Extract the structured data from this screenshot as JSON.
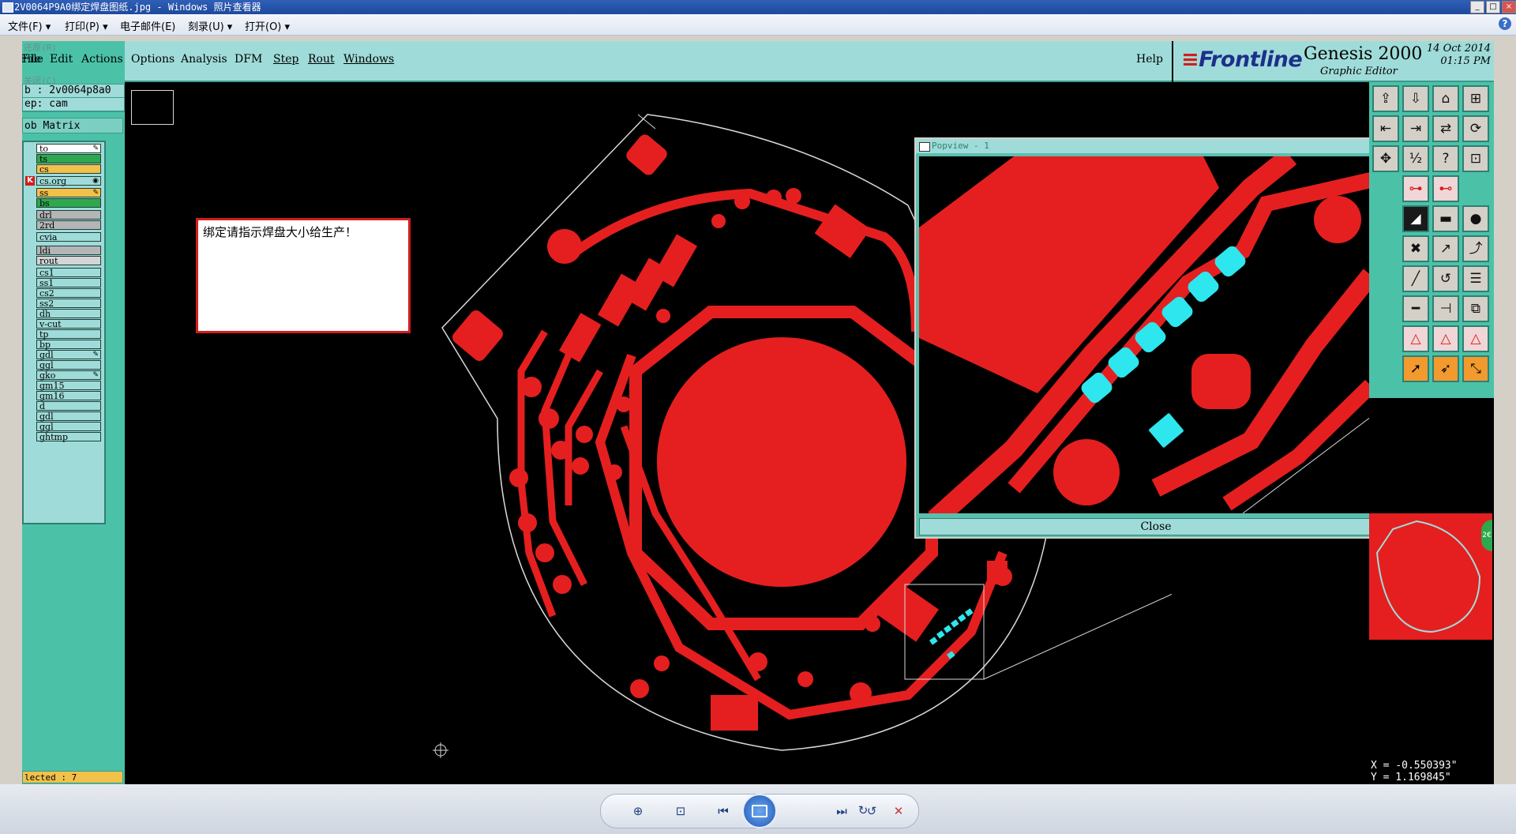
{
  "window": {
    "title": "2V0064P9A0绑定焊盘图纸.jpg - Windows 照片查看器",
    "controls": [
      "_",
      "□",
      "×"
    ]
  },
  "viewer_menu": [
    {
      "label": "文件(F) ▾"
    },
    {
      "label": "打印(P) ▾"
    },
    {
      "label": "电子邮件(E)"
    },
    {
      "label": "刻录(U) ▾"
    },
    {
      "label": "打开(O) ▾"
    }
  ],
  "viewer_help": "?",
  "genesis": {
    "menu": [
      {
        "label": "File"
      },
      {
        "label": "Edit"
      },
      {
        "label": "Actions"
      },
      {
        "label": "Options"
      },
      {
        "label": "Analysis"
      },
      {
        "label": "DFM"
      },
      {
        "label": "Step"
      },
      {
        "label": "Rout"
      },
      {
        "label": "Windows"
      }
    ],
    "help": "Help",
    "brand": {
      "logo": "Frontline",
      "product": "Genesis 2000",
      "subtitle": "Graphic Editor",
      "date": "14 Oct 2014",
      "time": "01:15 PM"
    },
    "job": "b : 2v0064p8a0",
    "step": "ep: cam",
    "matrix_button": "ob Matrix",
    "ghost_text": [
      "还原(R)",
      "",
      "",
      "关闭(C)"
    ],
    "layers": [
      {
        "name": "to",
        "color": "#ffffff",
        "mark": "✎"
      },
      {
        "name": "ts",
        "color": "#2ea84d",
        "mark": ""
      },
      {
        "name": "cs",
        "color": "#f2c14a",
        "mark": ""
      },
      {
        "name": "cs.org",
        "color": "#9fdcd9",
        "mark": "◉"
      },
      {
        "name": "ss",
        "color": "#f2c14a",
        "mark": "✎"
      },
      {
        "name": "bs",
        "color": "#2ea84d",
        "mark": ""
      },
      {
        "name": "drl",
        "color": "#b5b5b5",
        "mark": ""
      },
      {
        "name": "2rd",
        "color": "#b5b5b5",
        "mark": ""
      },
      {
        "name": "cvia",
        "color": "#9fdcd9",
        "mark": ""
      },
      {
        "name": "ldi",
        "color": "#b5b5b5",
        "mark": ""
      },
      {
        "name": "rout",
        "color": "#d4d4d4",
        "mark": ""
      },
      {
        "name": "cs1",
        "color": "#9fdcd9",
        "mark": ""
      },
      {
        "name": "ss1",
        "color": "#9fdcd9",
        "mark": ""
      },
      {
        "name": "cs2",
        "color": "#9fdcd9",
        "mark": ""
      },
      {
        "name": "ss2",
        "color": "#9fdcd9",
        "mark": ""
      },
      {
        "name": "dh",
        "color": "#9fdcd9",
        "mark": ""
      },
      {
        "name": "v-cut",
        "color": "#9fdcd9",
        "mark": ""
      },
      {
        "name": "tp",
        "color": "#9fdcd9",
        "mark": ""
      },
      {
        "name": "bp",
        "color": "#9fdcd9",
        "mark": ""
      },
      {
        "name": "gdl",
        "color": "#9fdcd9",
        "mark": "✎"
      },
      {
        "name": "ggl",
        "color": "#9fdcd9",
        "mark": ""
      },
      {
        "name": "gko",
        "color": "#9fdcd9",
        "mark": "✎"
      },
      {
        "name": "gm15",
        "color": "#9fdcd9",
        "mark": ""
      },
      {
        "name": "gm16",
        "color": "#9fdcd9",
        "mark": ""
      },
      {
        "name": "d",
        "color": "#9fdcd9",
        "mark": ""
      },
      {
        "name": "gdl",
        "color": "#9fdcd9",
        "mark": ""
      },
      {
        "name": "ggl",
        "color": "#9fdcd9",
        "mark": ""
      },
      {
        "name": "ghtmp",
        "color": "#9fdcd9",
        "mark": ""
      }
    ],
    "selected": "lected : 7",
    "note": "绑定请指示焊盘大小给生产！",
    "popview": {
      "title": "Popview - 1",
      "close": "Close"
    },
    "coords": {
      "x": "X = -0.550393\"",
      "y": "Y = 1.169845\""
    },
    "colors": {
      "copper": "#e51f1f",
      "pads": "#2ee6ee",
      "panel": "#4bc2a8",
      "menu": "#9fdcd9"
    }
  }
}
